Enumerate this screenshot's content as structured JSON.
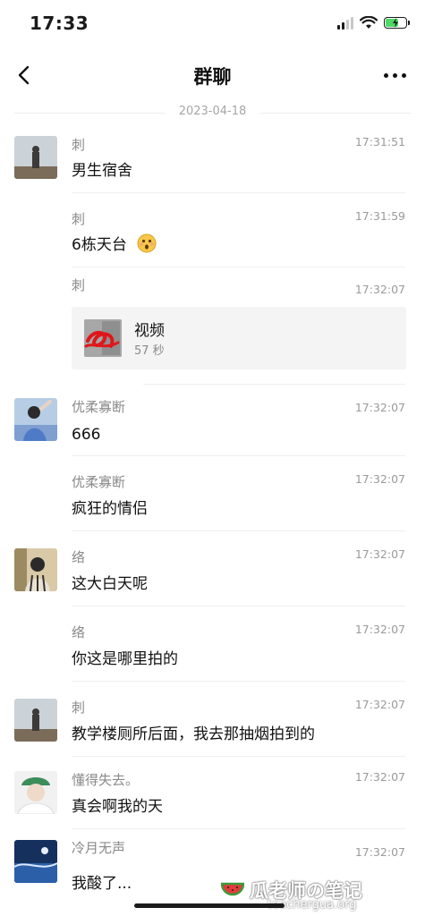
{
  "status_bar": {
    "time": "17:33"
  },
  "header": {
    "title": "群聊"
  },
  "date_divider": "2023-04-18",
  "messages": [
    {
      "sender": "刺",
      "time": "17:31:51",
      "text": "男生宿舍"
    },
    {
      "sender": "刺",
      "time": "17:31:59",
      "text": "6栋天台"
    },
    {
      "sender": "刺",
      "time": "17:32:07",
      "video": {
        "title": "视频",
        "duration": "57 秒"
      }
    },
    {
      "sender": "优柔寡断",
      "time": "17:32:07",
      "text": "666"
    },
    {
      "sender": "优柔寡断",
      "time": "17:32:07",
      "text": "疯狂的情侣"
    },
    {
      "sender": "络",
      "time": "17:32:07",
      "text": "这大白天呢"
    },
    {
      "sender": "络",
      "time": "17:32:07",
      "text": "你这是哪里拍的"
    },
    {
      "sender": "刺",
      "time": "17:32:07",
      "text": "教学楼厕所后面，我去那抽烟拍到的"
    },
    {
      "sender": "懂得失去。",
      "time": "17:32:07",
      "text": "真会啊我的天"
    },
    {
      "sender": "冷月无声",
      "time": "17:32:07",
      "text": "我酸了..."
    }
  ],
  "watermark": {
    "name": "瓜老师の笔记",
    "url": "teachergua.org"
  },
  "icons": {
    "back": "chevron-left-icon",
    "more": "more-dots-icon",
    "wifi": "wifi-icon",
    "signal": "signal-icon",
    "battery": "battery-charging-icon",
    "emoji": "surprised-emoji-icon",
    "watermark_logo": "watermelon-icon"
  },
  "colors": {
    "battery_fill": "#4cd964",
    "card_bg": "#f4f4f4"
  }
}
